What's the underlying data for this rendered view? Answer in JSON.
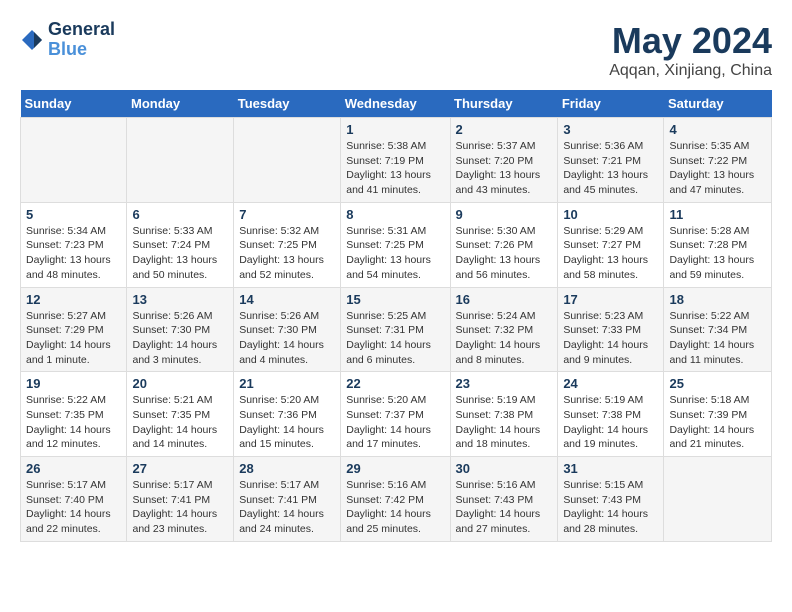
{
  "header": {
    "logo_line1": "General",
    "logo_line2": "Blue",
    "month": "May 2024",
    "location": "Aqqan, Xinjiang, China"
  },
  "weekdays": [
    "Sunday",
    "Monday",
    "Tuesday",
    "Wednesday",
    "Thursday",
    "Friday",
    "Saturday"
  ],
  "weeks": [
    [
      {
        "day": "",
        "content": ""
      },
      {
        "day": "",
        "content": ""
      },
      {
        "day": "",
        "content": ""
      },
      {
        "day": "1",
        "content": "Sunrise: 5:38 AM\nSunset: 7:19 PM\nDaylight: 13 hours\nand 41 minutes."
      },
      {
        "day": "2",
        "content": "Sunrise: 5:37 AM\nSunset: 7:20 PM\nDaylight: 13 hours\nand 43 minutes."
      },
      {
        "day": "3",
        "content": "Sunrise: 5:36 AM\nSunset: 7:21 PM\nDaylight: 13 hours\nand 45 minutes."
      },
      {
        "day": "4",
        "content": "Sunrise: 5:35 AM\nSunset: 7:22 PM\nDaylight: 13 hours\nand 47 minutes."
      }
    ],
    [
      {
        "day": "5",
        "content": "Sunrise: 5:34 AM\nSunset: 7:23 PM\nDaylight: 13 hours\nand 48 minutes."
      },
      {
        "day": "6",
        "content": "Sunrise: 5:33 AM\nSunset: 7:24 PM\nDaylight: 13 hours\nand 50 minutes."
      },
      {
        "day": "7",
        "content": "Sunrise: 5:32 AM\nSunset: 7:25 PM\nDaylight: 13 hours\nand 52 minutes."
      },
      {
        "day": "8",
        "content": "Sunrise: 5:31 AM\nSunset: 7:25 PM\nDaylight: 13 hours\nand 54 minutes."
      },
      {
        "day": "9",
        "content": "Sunrise: 5:30 AM\nSunset: 7:26 PM\nDaylight: 13 hours\nand 56 minutes."
      },
      {
        "day": "10",
        "content": "Sunrise: 5:29 AM\nSunset: 7:27 PM\nDaylight: 13 hours\nand 58 minutes."
      },
      {
        "day": "11",
        "content": "Sunrise: 5:28 AM\nSunset: 7:28 PM\nDaylight: 13 hours\nand 59 minutes."
      }
    ],
    [
      {
        "day": "12",
        "content": "Sunrise: 5:27 AM\nSunset: 7:29 PM\nDaylight: 14 hours\nand 1 minute."
      },
      {
        "day": "13",
        "content": "Sunrise: 5:26 AM\nSunset: 7:30 PM\nDaylight: 14 hours\nand 3 minutes."
      },
      {
        "day": "14",
        "content": "Sunrise: 5:26 AM\nSunset: 7:30 PM\nDaylight: 14 hours\nand 4 minutes."
      },
      {
        "day": "15",
        "content": "Sunrise: 5:25 AM\nSunset: 7:31 PM\nDaylight: 14 hours\nand 6 minutes."
      },
      {
        "day": "16",
        "content": "Sunrise: 5:24 AM\nSunset: 7:32 PM\nDaylight: 14 hours\nand 8 minutes."
      },
      {
        "day": "17",
        "content": "Sunrise: 5:23 AM\nSunset: 7:33 PM\nDaylight: 14 hours\nand 9 minutes."
      },
      {
        "day": "18",
        "content": "Sunrise: 5:22 AM\nSunset: 7:34 PM\nDaylight: 14 hours\nand 11 minutes."
      }
    ],
    [
      {
        "day": "19",
        "content": "Sunrise: 5:22 AM\nSunset: 7:35 PM\nDaylight: 14 hours\nand 12 minutes."
      },
      {
        "day": "20",
        "content": "Sunrise: 5:21 AM\nSunset: 7:35 PM\nDaylight: 14 hours\nand 14 minutes."
      },
      {
        "day": "21",
        "content": "Sunrise: 5:20 AM\nSunset: 7:36 PM\nDaylight: 14 hours\nand 15 minutes."
      },
      {
        "day": "22",
        "content": "Sunrise: 5:20 AM\nSunset: 7:37 PM\nDaylight: 14 hours\nand 17 minutes."
      },
      {
        "day": "23",
        "content": "Sunrise: 5:19 AM\nSunset: 7:38 PM\nDaylight: 14 hours\nand 18 minutes."
      },
      {
        "day": "24",
        "content": "Sunrise: 5:19 AM\nSunset: 7:38 PM\nDaylight: 14 hours\nand 19 minutes."
      },
      {
        "day": "25",
        "content": "Sunrise: 5:18 AM\nSunset: 7:39 PM\nDaylight: 14 hours\nand 21 minutes."
      }
    ],
    [
      {
        "day": "26",
        "content": "Sunrise: 5:17 AM\nSunset: 7:40 PM\nDaylight: 14 hours\nand 22 minutes."
      },
      {
        "day": "27",
        "content": "Sunrise: 5:17 AM\nSunset: 7:41 PM\nDaylight: 14 hours\nand 23 minutes."
      },
      {
        "day": "28",
        "content": "Sunrise: 5:17 AM\nSunset: 7:41 PM\nDaylight: 14 hours\nand 24 minutes."
      },
      {
        "day": "29",
        "content": "Sunrise: 5:16 AM\nSunset: 7:42 PM\nDaylight: 14 hours\nand 25 minutes."
      },
      {
        "day": "30",
        "content": "Sunrise: 5:16 AM\nSunset: 7:43 PM\nDaylight: 14 hours\nand 27 minutes."
      },
      {
        "day": "31",
        "content": "Sunrise: 5:15 AM\nSunset: 7:43 PM\nDaylight: 14 hours\nand 28 minutes."
      },
      {
        "day": "",
        "content": ""
      }
    ]
  ]
}
